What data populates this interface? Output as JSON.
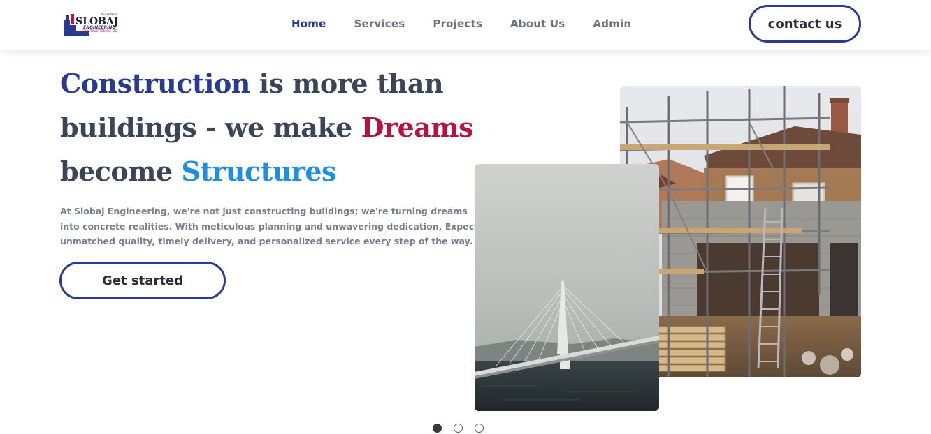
{
  "brand": {
    "name": "SLOBAJ",
    "sub": "ENGINEERING",
    "company": "CONSTRUCTION CO. LTD.",
    "rc": "RC: 1234250",
    "colors": {
      "navy": "#2a3a8f",
      "red": "#b8123f",
      "blue": "#1d8fe0"
    }
  },
  "nav": {
    "items": [
      {
        "label": "Home",
        "active": true
      },
      {
        "label": "Services",
        "active": false
      },
      {
        "label": "Projects",
        "active": false
      },
      {
        "label": "About Us",
        "active": false
      },
      {
        "label": "Admin",
        "active": false
      }
    ],
    "contact_label": "contact us"
  },
  "hero": {
    "headline": {
      "w1": "Construction",
      "p1": " is more than buildings - we make ",
      "w2": "Dreams",
      "p2": " become ",
      "w3": "Structures"
    },
    "intro": "At Slobaj Engineering, we're not just constructing buildings; we're turning dreams into concrete realities. With meticulous planning and unwavering dedication, Expect unmatched quality, timely delivery, and personalized service every step of the way.",
    "cta_label": "Get started"
  },
  "images": {
    "primary": "house-under-scaffolding-photo",
    "secondary": "cable-stayed-bridge-in-fog-photo"
  },
  "carousel": {
    "count": 3,
    "active": 1
  }
}
